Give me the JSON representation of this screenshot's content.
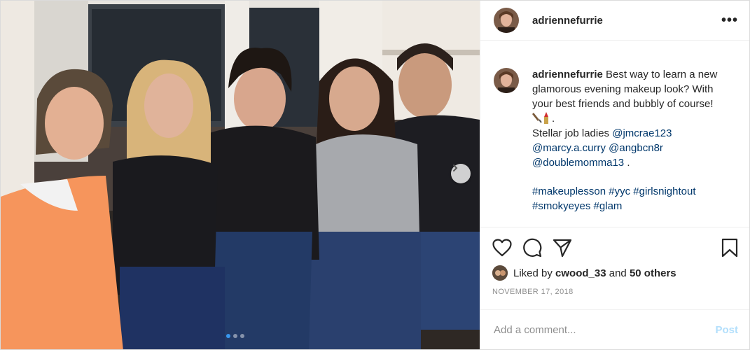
{
  "post": {
    "username": "adriennefurrie",
    "more_label": "•••",
    "caption": {
      "username": "adriennefurrie",
      "text_1": "Best way to learn a new glamorous evening makeup look? With your best friends and bubbly of course!",
      "text_2": ".",
      "line_3": "Stellar job ladies",
      "mentions": [
        "@jmcrae123",
        "@marcy.a.curry",
        "@angbcn8r",
        "@doublemomma13"
      ],
      "end_punct": ".",
      "hashtags": [
        "#makeuplesson",
        "#yyc",
        "#girlsnightout",
        "#smokyeyes",
        "#glam"
      ]
    },
    "likes": {
      "prefix": "Liked by",
      "user": "cwood_33",
      "conjunction": "and",
      "others": "50 others"
    },
    "date": "NOVEMBER 17, 2018",
    "comment": {
      "placeholder": "Add a comment...",
      "post_label": "Post"
    },
    "carousel": {
      "slide_count": 3,
      "active_index": 0
    }
  },
  "icons": {
    "like": "heart-icon",
    "comment": "comment-icon",
    "share": "share-icon",
    "save": "bookmark-icon",
    "next": "chevron-right-icon"
  },
  "colors": {
    "link": "#00376b",
    "post_button": "#b2dffc",
    "carousel_active": "#3897f0"
  }
}
